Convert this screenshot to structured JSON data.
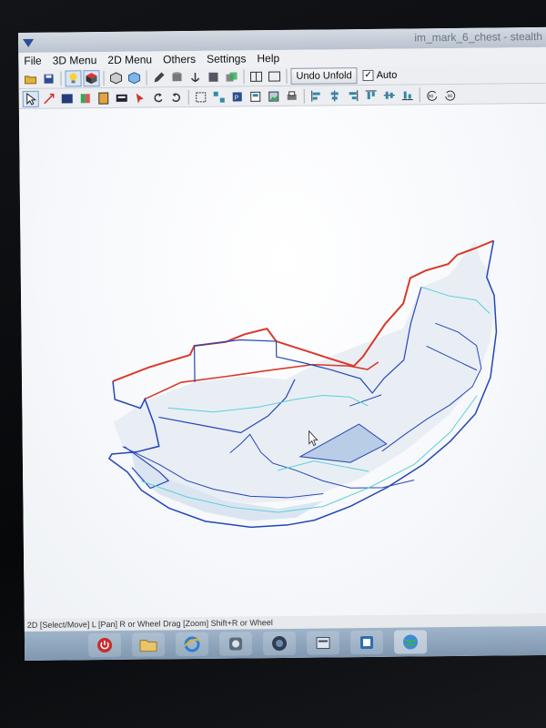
{
  "window": {
    "title": "im_mark_6_chest - stealth"
  },
  "menu": [
    "File",
    "3D Menu",
    "2D Menu",
    "Others",
    "Settings",
    "Help"
  ],
  "toolbar1": {
    "undo_unfold_label": "Undo Unfold",
    "auto_label": "Auto",
    "auto_checked": "✓"
  },
  "status": {
    "text": "2D [Select/Move] L [Pan] R or Wheel Drag [Zoom] Shift+R or Wheel"
  },
  "colors": {
    "edge_blue": "#2446b8",
    "edge_red": "#d83a2a",
    "edge_cyan": "#5ad0d8",
    "face_fill": "#cfe0f2"
  },
  "taskbar_icons": [
    "power-icon",
    "folder-icon",
    "ie-icon",
    "program-icon",
    "media-icon",
    "app-icon",
    "window-icon",
    "globe-icon"
  ]
}
